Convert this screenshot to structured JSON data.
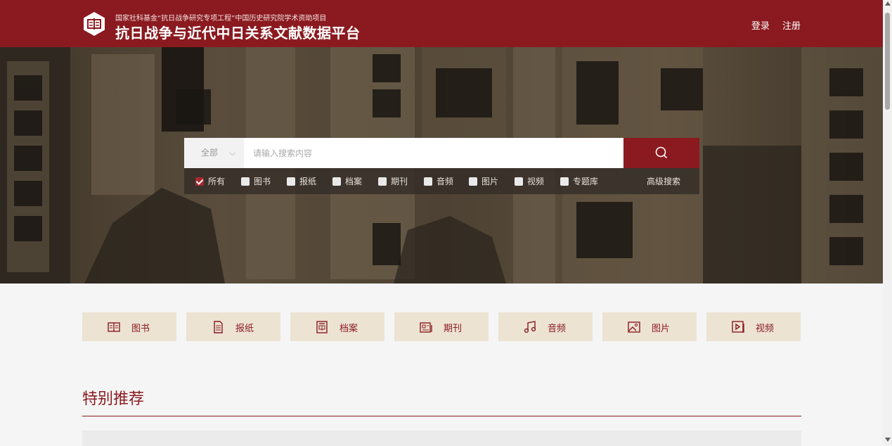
{
  "header": {
    "subtitle": "国家社科基金“抗日战争研究专项工程”中国历史研究院学术资助项目",
    "title": "抗日战争与近代中日关系文献数据平台",
    "login": "登录",
    "register": "注册"
  },
  "search": {
    "scope": "全部",
    "placeholder": "请输入搜索内容",
    "filters": [
      {
        "label": "所有",
        "checked": true
      },
      {
        "label": "图书",
        "checked": false
      },
      {
        "label": "报纸",
        "checked": false
      },
      {
        "label": "档案",
        "checked": false
      },
      {
        "label": "期刊",
        "checked": false
      },
      {
        "label": "音频",
        "checked": false
      },
      {
        "label": "图片",
        "checked": false
      },
      {
        "label": "视频",
        "checked": false
      },
      {
        "label": "专题库",
        "checked": false
      }
    ],
    "advanced": "高级搜索"
  },
  "categories": [
    {
      "label": "图书",
      "icon": "book-icon"
    },
    {
      "label": "报纸",
      "icon": "newspaper-icon"
    },
    {
      "label": "档案",
      "icon": "archive-icon"
    },
    {
      "label": "期刊",
      "icon": "journal-icon"
    },
    {
      "label": "音频",
      "icon": "music-icon"
    },
    {
      "label": "图片",
      "icon": "image-icon"
    },
    {
      "label": "视频",
      "icon": "video-icon"
    }
  ],
  "recommend": {
    "title": "特别推荐"
  },
  "colors": {
    "brand": "#8a1a1f",
    "tile": "#ece3d3"
  }
}
